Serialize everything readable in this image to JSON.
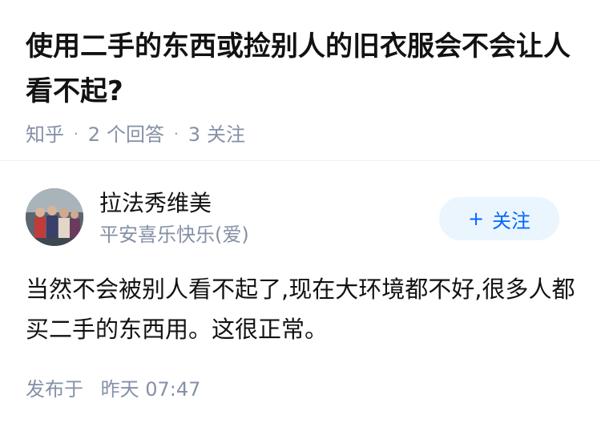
{
  "question": {
    "title": "使用二手的东西或捡别人的旧衣服会不会让人看不起?",
    "source": "知乎",
    "answer_count": "2",
    "answer_label": "个回答",
    "follow_count": "3",
    "follow_label": "关注"
  },
  "answer": {
    "author_name": "拉法秀维美",
    "author_bio": "平安喜乐快乐(爱)",
    "follow_button": {
      "icon": "plus-icon",
      "plus": "+",
      "label": "关注"
    },
    "content": "当然不会被别人看不起了,现在大环境都不好,很多人都买二手的东西用。这很正常。",
    "published_label": "发布于",
    "published_time": "昨天 07:47"
  },
  "colors": {
    "text": "#121212",
    "meta": "#8590a6",
    "accent": "#0066ff",
    "accent_bg": "#ebf5fd"
  }
}
